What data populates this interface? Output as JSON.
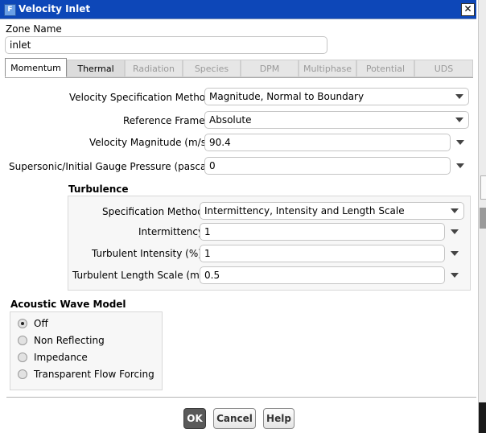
{
  "window": {
    "title": "Velocity Inlet",
    "app_icon": "F",
    "close": "✕"
  },
  "zone": {
    "label": "Zone Name",
    "value": "inlet"
  },
  "tabs": [
    {
      "label": "Momentum",
      "state": "active"
    },
    {
      "label": "Thermal",
      "state": "enabled"
    },
    {
      "label": "Radiation",
      "state": "disabled"
    },
    {
      "label": "Species",
      "state": "disabled"
    },
    {
      "label": "DPM",
      "state": "disabled"
    },
    {
      "label": "Multiphase",
      "state": "disabled"
    },
    {
      "label": "Potential",
      "state": "disabled"
    },
    {
      "label": "UDS",
      "state": "disabled"
    }
  ],
  "momentum": {
    "velocity_spec_method": {
      "label": "Velocity Specification Method",
      "value": "Magnitude, Normal to Boundary"
    },
    "reference_frame": {
      "label": "Reference Frame",
      "value": "Absolute"
    },
    "velocity_magnitude": {
      "label": "Velocity Magnitude (m/s)",
      "value": "90.4"
    },
    "gauge_pressure": {
      "label": "Supersonic/Initial Gauge Pressure (pascal)",
      "value": "0"
    }
  },
  "turbulence": {
    "title": "Turbulence",
    "spec_method": {
      "label": "Specification Method",
      "value": "Intermittency, Intensity and Length Scale"
    },
    "intermittency": {
      "label": "Intermittency",
      "value": "1"
    },
    "intensity": {
      "label": "Turbulent Intensity (%)",
      "value": "1"
    },
    "length_scale": {
      "label": "Turbulent Length Scale (m)",
      "value": "0.5"
    }
  },
  "acoustic": {
    "title": "Acoustic Wave Model",
    "options": [
      {
        "label": "Off",
        "selected": true
      },
      {
        "label": "Non Reflecting",
        "selected": false
      },
      {
        "label": "Impedance",
        "selected": false
      },
      {
        "label": "Transparent Flow Forcing",
        "selected": false
      }
    ]
  },
  "buttons": {
    "ok": "OK",
    "cancel": "Cancel",
    "help": "Help"
  },
  "colors": {
    "titlebar": "#0d47b8",
    "ok_button": "#5a5a5a"
  }
}
